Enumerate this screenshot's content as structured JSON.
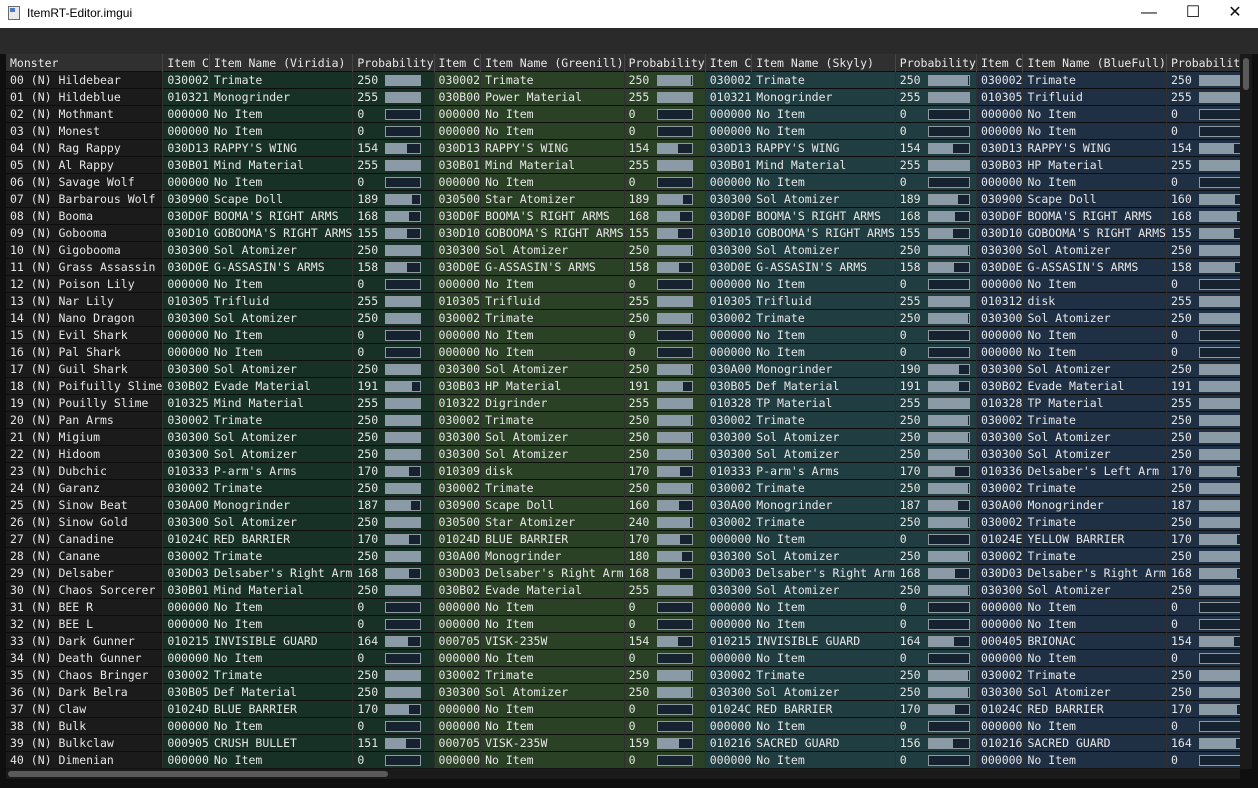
{
  "window": {
    "title": "ItemRT-Editor.imgui"
  },
  "colors": {
    "grid0": "#173127",
    "grid1": "#2a4126",
    "grid2": "#203d41",
    "grid3": "#1f2f44",
    "bar_fill": "#8a9aa6"
  },
  "columns": [
    "Monster",
    "Item C",
    "Item Name (Viridia)",
    "Probability",
    "Item C",
    "Item Name (Greenill)",
    "Probability",
    "Item C",
    "Item Name (Skyly)",
    "Probability",
    "Item C",
    "Item Name (BlueFull)",
    "Probability (BlueFull)"
  ],
  "rows": [
    {
      "monster": "00 (N) Hildebear",
      "cells": [
        [
          "030002",
          "Trimate",
          "250"
        ],
        [
          "030002",
          "Trimate",
          "250"
        ],
        [
          "030002",
          "Trimate",
          "250"
        ],
        [
          "030002",
          "Trimate",
          "250"
        ]
      ]
    },
    {
      "monster": "01 (N) Hildeblue",
      "cells": [
        [
          "010321",
          "Monogrinder",
          "255"
        ],
        [
          "030B00",
          "Power Material",
          "255"
        ],
        [
          "010321",
          "Monogrinder",
          "255"
        ],
        [
          "010305",
          "Trifluid",
          "255"
        ]
      ]
    },
    {
      "monster": "02 (N) Mothmant",
      "cells": [
        [
          "000000",
          "No Item",
          "0"
        ],
        [
          "000000",
          "No Item",
          "0"
        ],
        [
          "000000",
          "No Item",
          "0"
        ],
        [
          "000000",
          "No Item",
          "0"
        ]
      ]
    },
    {
      "monster": "03 (N) Monest",
      "cells": [
        [
          "000000",
          "No Item",
          "0"
        ],
        [
          "000000",
          "No Item",
          "0"
        ],
        [
          "000000",
          "No Item",
          "0"
        ],
        [
          "000000",
          "No Item",
          "0"
        ]
      ]
    },
    {
      "monster": "04 (N) Rag Rappy",
      "cells": [
        [
          "030D13",
          "RAPPY'S WING",
          "154"
        ],
        [
          "030D13",
          "RAPPY'S WING",
          "154"
        ],
        [
          "030D13",
          "RAPPY'S WING",
          "154"
        ],
        [
          "030D13",
          "RAPPY'S WING",
          "154"
        ]
      ]
    },
    {
      "monster": "05 (N) Al Rappy",
      "cells": [
        [
          "030B01",
          "Mind Material",
          "255"
        ],
        [
          "030B01",
          "Mind Material",
          "255"
        ],
        [
          "030B01",
          "Mind Material",
          "255"
        ],
        [
          "030B03",
          "HP Material",
          "255"
        ]
      ]
    },
    {
      "monster": "06 (N) Savage Wolf",
      "cells": [
        [
          "000000",
          "No Item",
          "0"
        ],
        [
          "000000",
          "No Item",
          "0"
        ],
        [
          "000000",
          "No Item",
          "0"
        ],
        [
          "000000",
          "No Item",
          "0"
        ]
      ]
    },
    {
      "monster": "07 (N) Barbarous Wolf",
      "cells": [
        [
          "030900",
          "Scape Doll",
          "189"
        ],
        [
          "030500",
          "Star Atomizer",
          "189"
        ],
        [
          "030300",
          "Sol Atomizer",
          "189"
        ],
        [
          "030900",
          "Scape Doll",
          "160"
        ]
      ]
    },
    {
      "monster": "08 (N) Booma",
      "cells": [
        [
          "030D0F",
          "BOOMA'S RIGHT ARMS",
          "168"
        ],
        [
          "030D0F",
          "BOOMA'S RIGHT ARMS",
          "168"
        ],
        [
          "030D0F",
          "BOOMA'S RIGHT ARMS",
          "168"
        ],
        [
          "030D0F",
          "BOOMA'S RIGHT ARMS",
          "168"
        ]
      ]
    },
    {
      "monster": "09 (N) Gobooma",
      "cells": [
        [
          "030D10",
          "GOBOOMA'S RIGHT ARMS",
          "155"
        ],
        [
          "030D10",
          "GOBOOMA'S RIGHT ARMS",
          "155"
        ],
        [
          "030D10",
          "GOBOOMA'S RIGHT ARMS",
          "155"
        ],
        [
          "030D10",
          "GOBOOMA'S RIGHT ARMS",
          "155"
        ]
      ]
    },
    {
      "monster": "10 (N) Gigobooma",
      "cells": [
        [
          "030300",
          "Sol Atomizer",
          "250"
        ],
        [
          "030300",
          "Sol Atomizer",
          "250"
        ],
        [
          "030300",
          "Sol Atomizer",
          "250"
        ],
        [
          "030300",
          "Sol Atomizer",
          "250"
        ]
      ]
    },
    {
      "monster": "11 (N) Grass Assassin",
      "cells": [
        [
          "030D0E",
          "G-ASSASIN'S ARMS",
          "158"
        ],
        [
          "030D0E",
          "G-ASSASIN'S ARMS",
          "158"
        ],
        [
          "030D0E",
          "G-ASSASIN'S ARMS",
          "158"
        ],
        [
          "030D0E",
          "G-ASSASIN'S ARMS",
          "158"
        ]
      ]
    },
    {
      "monster": "12 (N) Poison Lily",
      "cells": [
        [
          "000000",
          "No Item",
          "0"
        ],
        [
          "000000",
          "No Item",
          "0"
        ],
        [
          "000000",
          "No Item",
          "0"
        ],
        [
          "000000",
          "No Item",
          "0"
        ]
      ]
    },
    {
      "monster": "13 (N) Nar Lily",
      "cells": [
        [
          "010305",
          "Trifluid",
          "255"
        ],
        [
          "010305",
          "Trifluid",
          "255"
        ],
        [
          "010305",
          "Trifluid",
          "255"
        ],
        [
          "010312",
          "disk",
          "255"
        ]
      ]
    },
    {
      "monster": "14 (N) Nano Dragon",
      "cells": [
        [
          "030300",
          "Sol Atomizer",
          "250"
        ],
        [
          "030002",
          "Trimate",
          "250"
        ],
        [
          "030002",
          "Trimate",
          "250"
        ],
        [
          "030300",
          "Sol Atomizer",
          "250"
        ]
      ]
    },
    {
      "monster": "15 (N) Evil Shark",
      "cells": [
        [
          "000000",
          "No Item",
          "0"
        ],
        [
          "000000",
          "No Item",
          "0"
        ],
        [
          "000000",
          "No Item",
          "0"
        ],
        [
          "000000",
          "No Item",
          "0"
        ]
      ]
    },
    {
      "monster": "16 (N) Pal Shark",
      "cells": [
        [
          "000000",
          "No Item",
          "0"
        ],
        [
          "000000",
          "No Item",
          "0"
        ],
        [
          "000000",
          "No Item",
          "0"
        ],
        [
          "000000",
          "No Item",
          "0"
        ]
      ]
    },
    {
      "monster": "17 (N) Guil Shark",
      "cells": [
        [
          "030300",
          "Sol Atomizer",
          "250"
        ],
        [
          "030300",
          "Sol Atomizer",
          "250"
        ],
        [
          "030A00",
          "Monogrinder",
          "190"
        ],
        [
          "030300",
          "Sol Atomizer",
          "250"
        ]
      ]
    },
    {
      "monster": "18 (N) Poifuilly Slime",
      "cells": [
        [
          "030B02",
          "Evade Material",
          "191"
        ],
        [
          "030B03",
          "HP Material",
          "191"
        ],
        [
          "030B05",
          "Def Material",
          "191"
        ],
        [
          "030B02",
          "Evade Material",
          "191"
        ]
      ]
    },
    {
      "monster": "19 (N) Pouilly Slime",
      "cells": [
        [
          "010325",
          "Mind Material",
          "255"
        ],
        [
          "010322",
          "Digrinder",
          "255"
        ],
        [
          "010328",
          "TP Material",
          "255"
        ],
        [
          "010328",
          "TP Material",
          "255"
        ]
      ]
    },
    {
      "monster": "20 (N) Pan Arms",
      "cells": [
        [
          "030002",
          "Trimate",
          "250"
        ],
        [
          "030002",
          "Trimate",
          "250"
        ],
        [
          "030002",
          "Trimate",
          "250"
        ],
        [
          "030002",
          "Trimate",
          "250"
        ]
      ]
    },
    {
      "monster": "21 (N) Migium",
      "cells": [
        [
          "030300",
          "Sol Atomizer",
          "250"
        ],
        [
          "030300",
          "Sol Atomizer",
          "250"
        ],
        [
          "030300",
          "Sol Atomizer",
          "250"
        ],
        [
          "030300",
          "Sol Atomizer",
          "250"
        ]
      ]
    },
    {
      "monster": "22 (N) Hidoom",
      "cells": [
        [
          "030300",
          "Sol Atomizer",
          "250"
        ],
        [
          "030300",
          "Sol Atomizer",
          "250"
        ],
        [
          "030300",
          "Sol Atomizer",
          "250"
        ],
        [
          "030300",
          "Sol Atomizer",
          "250"
        ]
      ]
    },
    {
      "monster": "23 (N) Dubchic",
      "cells": [
        [
          "010333",
          "P-arm's Arms",
          "170"
        ],
        [
          "010309",
          "disk",
          "170"
        ],
        [
          "010333",
          "P-arm's Arms",
          "170"
        ],
        [
          "010336",
          "Delsaber's Left Arm",
          "170"
        ]
      ]
    },
    {
      "monster": "24 (N) Garanz",
      "cells": [
        [
          "030002",
          "Trimate",
          "250"
        ],
        [
          "030002",
          "Trimate",
          "250"
        ],
        [
          "030002",
          "Trimate",
          "250"
        ],
        [
          "030002",
          "Trimate",
          "250"
        ]
      ]
    },
    {
      "monster": "25 (N) Sinow Beat",
      "cells": [
        [
          "030A00",
          "Monogrinder",
          "187"
        ],
        [
          "030900",
          "Scape Doll",
          "160"
        ],
        [
          "030A00",
          "Monogrinder",
          "187"
        ],
        [
          "030A00",
          "Monogrinder",
          "187"
        ]
      ]
    },
    {
      "monster": "26 (N) Sinow Gold",
      "cells": [
        [
          "030300",
          "Sol Atomizer",
          "250"
        ],
        [
          "030500",
          "Star Atomizer",
          "240"
        ],
        [
          "030002",
          "Trimate",
          "250"
        ],
        [
          "030002",
          "Trimate",
          "250"
        ]
      ]
    },
    {
      "monster": "27 (N) Canadine",
      "cells": [
        [
          "01024C",
          "RED BARRIER",
          "170"
        ],
        [
          "01024D",
          "BLUE BARRIER",
          "170"
        ],
        [
          "000000",
          "No Item",
          "0"
        ],
        [
          "01024E",
          "YELLOW BARRIER",
          "170"
        ]
      ]
    },
    {
      "monster": "28 (N) Canane",
      "cells": [
        [
          "030002",
          "Trimate",
          "250"
        ],
        [
          "030A00",
          "Monogrinder",
          "180"
        ],
        [
          "030300",
          "Sol Atomizer",
          "250"
        ],
        [
          "030002",
          "Trimate",
          "250"
        ]
      ]
    },
    {
      "monster": "29 (N) Delsaber",
      "cells": [
        [
          "030D03",
          "Delsaber's Right Arm",
          "168"
        ],
        [
          "030D03",
          "Delsaber's Right Arm",
          "168"
        ],
        [
          "030D03",
          "Delsaber's Right Arm",
          "168"
        ],
        [
          "030D03",
          "Delsaber's Right Arm",
          "168"
        ]
      ]
    },
    {
      "monster": "30 (N) Chaos Sorcerer",
      "cells": [
        [
          "030B01",
          "Mind Material",
          "250"
        ],
        [
          "030B02",
          "Evade Material",
          "255"
        ],
        [
          "030300",
          "Sol Atomizer",
          "250"
        ],
        [
          "030300",
          "Sol Atomizer",
          "250"
        ]
      ]
    },
    {
      "monster": "31 (N) BEE R",
      "cells": [
        [
          "000000",
          "No Item",
          "0"
        ],
        [
          "000000",
          "No Item",
          "0"
        ],
        [
          "000000",
          "No Item",
          "0"
        ],
        [
          "000000",
          "No Item",
          "0"
        ]
      ]
    },
    {
      "monster": "32 (N) BEE L",
      "cells": [
        [
          "000000",
          "No Item",
          "0"
        ],
        [
          "000000",
          "No Item",
          "0"
        ],
        [
          "000000",
          "No Item",
          "0"
        ],
        [
          "000000",
          "No Item",
          "0"
        ]
      ]
    },
    {
      "monster": "33 (N) Dark Gunner",
      "cells": [
        [
          "010215",
          "INVISIBLE GUARD",
          "164"
        ],
        [
          "000705",
          "VISK-235W",
          "154"
        ],
        [
          "010215",
          "INVISIBLE GUARD",
          "164"
        ],
        [
          "000405",
          "BRIONAC",
          "154"
        ]
      ]
    },
    {
      "monster": "34 (N) Death Gunner",
      "cells": [
        [
          "000000",
          "No Item",
          "0"
        ],
        [
          "000000",
          "No Item",
          "0"
        ],
        [
          "000000",
          "No Item",
          "0"
        ],
        [
          "000000",
          "No Item",
          "0"
        ]
      ]
    },
    {
      "monster": "35 (N) Chaos Bringer",
      "cells": [
        [
          "030002",
          "Trimate",
          "250"
        ],
        [
          "030002",
          "Trimate",
          "250"
        ],
        [
          "030002",
          "Trimate",
          "250"
        ],
        [
          "030002",
          "Trimate",
          "250"
        ]
      ]
    },
    {
      "monster": "36 (N) Dark Belra",
      "cells": [
        [
          "030B05",
          "Def Material",
          "250"
        ],
        [
          "030300",
          "Sol Atomizer",
          "250"
        ],
        [
          "030300",
          "Sol Atomizer",
          "250"
        ],
        [
          "030300",
          "Sol Atomizer",
          "250"
        ]
      ]
    },
    {
      "monster": "37 (N) Claw",
      "cells": [
        [
          "01024D",
          "BLUE BARRIER",
          "170"
        ],
        [
          "000000",
          "No Item",
          "0"
        ],
        [
          "01024C",
          "RED BARRIER",
          "170"
        ],
        [
          "01024C",
          "RED BARRIER",
          "170"
        ]
      ]
    },
    {
      "monster": "38 (N) Bulk",
      "cells": [
        [
          "000000",
          "No Item",
          "0"
        ],
        [
          "000000",
          "No Item",
          "0"
        ],
        [
          "000000",
          "No Item",
          "0"
        ],
        [
          "000000",
          "No Item",
          "0"
        ]
      ]
    },
    {
      "monster": "39 (N) Bulkclaw",
      "cells": [
        [
          "000905",
          "CRUSH BULLET",
          "151"
        ],
        [
          "000705",
          "VISK-235W",
          "159"
        ],
        [
          "010216",
          "SACRED GUARD",
          "156"
        ],
        [
          "010216",
          "SACRED GUARD",
          "164"
        ]
      ]
    },
    {
      "monster": "40 (N) Dimenian",
      "cells": [
        [
          "000000",
          "No Item",
          "0"
        ],
        [
          "000000",
          "No Item",
          "0"
        ],
        [
          "000000",
          "No Item",
          "0"
        ],
        [
          "000000",
          "No Item",
          "0"
        ]
      ]
    }
  ]
}
